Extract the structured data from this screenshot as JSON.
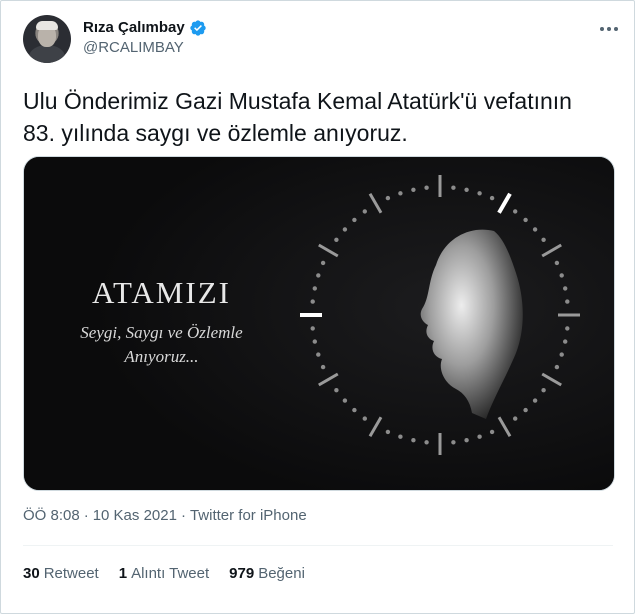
{
  "author": {
    "name": "Rıza Çalımbay",
    "handle": "@RCALIMBAY",
    "verified": true
  },
  "tweet": {
    "text_line1": "Ulu Önderimiz Gazi Mustafa Kemal Atatürk'ü vefatının",
    "text_line2": "83. yılında saygı ve özlemle anıyoruz."
  },
  "media": {
    "title": "ATAMIZI",
    "subtitle_line1": "Seygi, Saygı ve Özlemle",
    "subtitle_line2": "Anıyoruz..."
  },
  "meta": {
    "time": "ÖÖ 8:08",
    "date": "10 Kas 2021",
    "source": "Twitter for iPhone"
  },
  "stats": {
    "retweets_count": "30",
    "retweets_label": "Retweet",
    "quotes_count": "1",
    "quotes_label": "Alıntı Tweet",
    "likes_count": "979",
    "likes_label": "Beğeni"
  },
  "colors": {
    "verified": "#1d9bf0",
    "secondary_text": "#536471",
    "media_bg": "#0f0f10"
  },
  "icons": [
    "verified-badge-icon",
    "more-icon"
  ]
}
